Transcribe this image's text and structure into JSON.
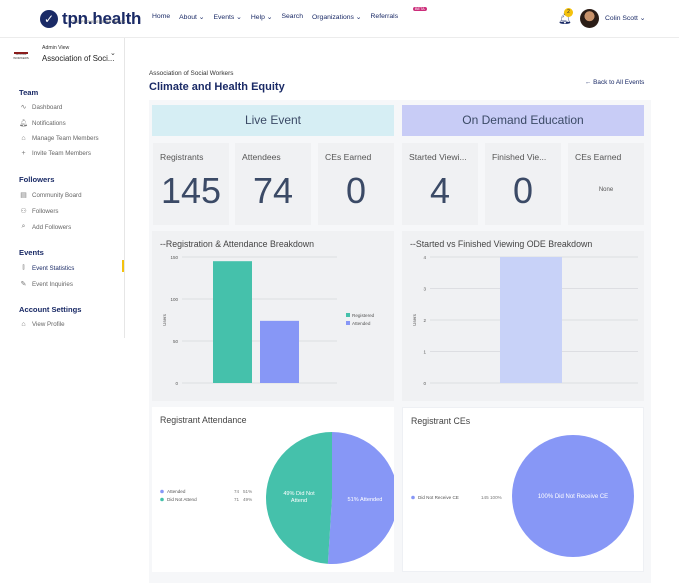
{
  "topbar": {
    "logo_mark": "✓",
    "logo_text": "tpn.health",
    "logo_sub": "THE PROVIDERS NETWORK",
    "nav": [
      "Home",
      "About ⌄",
      "Events ⌄",
      "Help ⌄",
      "Search",
      "Organizations ⌄",
      "Referrals"
    ],
    "beta": "BETA",
    "notification_count": "2",
    "user_name": "Colin Scott ⌄"
  },
  "sidebar": {
    "org_logo_text": "SOCIAL WORKERS",
    "admin_view": "Admin View",
    "org_name": "Association of Soci...",
    "sections": [
      {
        "title": "Team",
        "items": [
          {
            "icon": "pulse-icon",
            "glyph": "∿",
            "label": "Dashboard"
          },
          {
            "icon": "bell-icon",
            "glyph": "🔔︎",
            "label": "Notifications"
          },
          {
            "icon": "team-icon",
            "glyph": "⌂",
            "label": "Manage Team Members"
          },
          {
            "icon": "invite-icon",
            "glyph": "+",
            "label": "Invite Team Members"
          }
        ]
      },
      {
        "title": "Followers",
        "items": [
          {
            "icon": "board-icon",
            "glyph": "▤",
            "label": "Community Board"
          },
          {
            "icon": "followers-icon",
            "glyph": "⚇",
            "label": "Followers"
          },
          {
            "icon": "search-icon",
            "glyph": "⌕",
            "label": "Add Followers"
          }
        ]
      },
      {
        "title": "Events",
        "items": [
          {
            "icon": "stats-icon",
            "glyph": "⫾",
            "label": "Event Statistics"
          },
          {
            "icon": "inquiry-icon",
            "glyph": "✎",
            "label": "Event Inquiries"
          }
        ]
      },
      {
        "title": "Account Settings",
        "items": [
          {
            "icon": "profile-icon",
            "glyph": "⌂",
            "label": "View Profile"
          }
        ]
      }
    ],
    "active_item": "Event Statistics"
  },
  "main": {
    "breadcrumb": "Association of Social Workers",
    "title": "Climate and Health Equity",
    "back_link": "← Back to All Events",
    "live_header": "Live Event",
    "ode_header": "On Demand Education",
    "stats": [
      {
        "label": "Registrants",
        "value": "145"
      },
      {
        "label": "Attendees",
        "value": "74"
      },
      {
        "label": "CEs Earned",
        "value": "0"
      },
      {
        "label": "Started Viewi...",
        "value": "4"
      },
      {
        "label": "Finished Vie...",
        "value": "0"
      },
      {
        "label": "CEs Earned",
        "value": "",
        "note": "None"
      }
    ]
  },
  "chart_data": [
    {
      "type": "bar",
      "title": "--Registration & Attendance Breakdown",
      "ylabel": "Users",
      "ylim": [
        0,
        150
      ],
      "yticks": [
        "0",
        "50",
        "100",
        "150"
      ],
      "series": [
        {
          "name": "Registered",
          "values": [
            145
          ],
          "color": "#45c1ab"
        },
        {
          "name": "Attended",
          "values": [
            74
          ],
          "color": "#8797f6"
        }
      ]
    },
    {
      "type": "bar",
      "title": "--Started vs Finished Viewing ODE Breakdown",
      "ylabel": "Users",
      "ylim": [
        0,
        4
      ],
      "yticks": [
        "0",
        "1",
        "2",
        "3",
        "4"
      ],
      "series": [
        {
          "name": "Started",
          "values": [
            4
          ],
          "color": "#c8d2f8"
        }
      ]
    },
    {
      "type": "pie",
      "title": "Registrant Attendance",
      "slices": [
        {
          "label": "Attended",
          "value": 51,
          "count": "74",
          "percent": "51%",
          "slice_label": "51% Attended",
          "color": "#8797f6"
        },
        {
          "label": "Did Not Attend",
          "value": 49,
          "count": "71",
          "percent": "49%",
          "slice_label": "49% Did Not Attend",
          "color": "#45c1ab"
        }
      ]
    },
    {
      "type": "pie",
      "title": "Registrant CEs",
      "slices": [
        {
          "label": "Did Not Receive CE",
          "value": 100,
          "count": "145",
          "percent": "100%",
          "slice_label": "100% Did Not Receive CE",
          "color": "#8797f6"
        }
      ]
    }
  ]
}
